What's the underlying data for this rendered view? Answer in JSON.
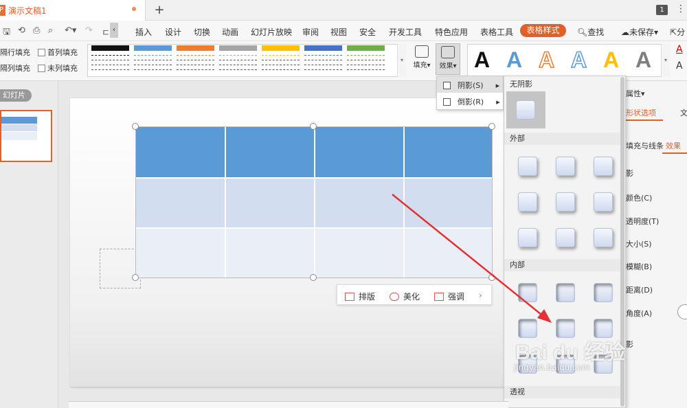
{
  "app": {
    "doc_title": "演示文稿1",
    "page_badge": "1",
    "icon_letter": "P"
  },
  "menu": {
    "items": [
      "插入",
      "设计",
      "切换",
      "动画",
      "幻灯片放映",
      "审阅",
      "视图",
      "安全",
      "开发工具",
      "特色应用",
      "表格工具"
    ],
    "table_style": "表格样式",
    "search": "查找",
    "unsaved": "未保存",
    "share": "分"
  },
  "ribbon": {
    "options": {
      "row_fill": "隔行填充",
      "first_col": "首列填充",
      "col_fill": "隔列填充",
      "last_col": "末列填充"
    },
    "style_swatch_colors": [
      "#111111",
      "#5b9bd5",
      "#ed7d31",
      "#a5a5a5",
      "#ffc000",
      "#4472c4",
      "#70ad47"
    ],
    "fill_label": "填充",
    "effect_label": "效果",
    "wordart": [
      {
        "char": "A",
        "color": "#111111"
      },
      {
        "char": "A",
        "color": "#5b9bd5"
      },
      {
        "char": "A",
        "color": "#ed7d31"
      },
      {
        "char": "A",
        "color": "#5b9bd5"
      },
      {
        "char": "A",
        "color": "#ffc000"
      },
      {
        "char": "A",
        "color": "#7f7f7f"
      }
    ]
  },
  "left": {
    "slides_label": "幻灯片"
  },
  "float_toolbar": {
    "layout": "排版",
    "beautify": "美化",
    "emphasize": "强调"
  },
  "effect_menu": {
    "shadow": "阴影(S)",
    "reflection": "倒影(R)"
  },
  "shadow_panel": {
    "no_shadow": "无阴影",
    "outer": "外部",
    "inner": "内部",
    "perspective": "透视"
  },
  "right_pane": {
    "props": "属性",
    "tab_shape": "形状选项",
    "tab_text": "文",
    "fill_line": "填充与线条",
    "effects": "效果",
    "fields": [
      "影",
      "颜色(C)",
      "透明度(T)",
      "大小(S)",
      "模糊(B)",
      "距离(D)",
      "角度(A)",
      "影"
    ]
  },
  "watermark": {
    "main": "Bai du 经验",
    "url": "jingyan.baidu.com"
  }
}
